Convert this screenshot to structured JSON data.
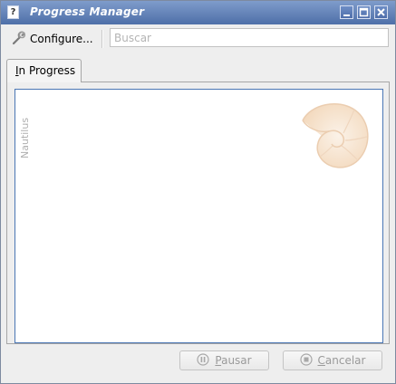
{
  "window": {
    "title": "Progress Manager",
    "controls": {
      "minimize": "minimize-icon",
      "maximize": "maximize-icon",
      "close": "close-icon"
    }
  },
  "toolbar": {
    "configure_label": "Configure...",
    "configure_icon": "wrench-icon",
    "search_placeholder": "Buscar",
    "search_value": ""
  },
  "tabs": [
    {
      "label_accel": "I",
      "label_rest": "n Progress",
      "active": true
    }
  ],
  "list": {
    "source_label": "Nautilus",
    "watermark_icon": "nautilus-shell-icon"
  },
  "buttons": {
    "pause": {
      "accel": "P",
      "rest": "ausar",
      "icon": "pause-icon",
      "enabled": false
    },
    "cancel": {
      "accel": "C",
      "rest": "ancelar",
      "icon": "stop-icon",
      "enabled": false
    }
  },
  "colors": {
    "titlebar_top": "#7f9ccb",
    "titlebar_bottom": "#4e6fa8",
    "list_border": "#4a76b4",
    "disabled_text": "#9a9a9a"
  }
}
